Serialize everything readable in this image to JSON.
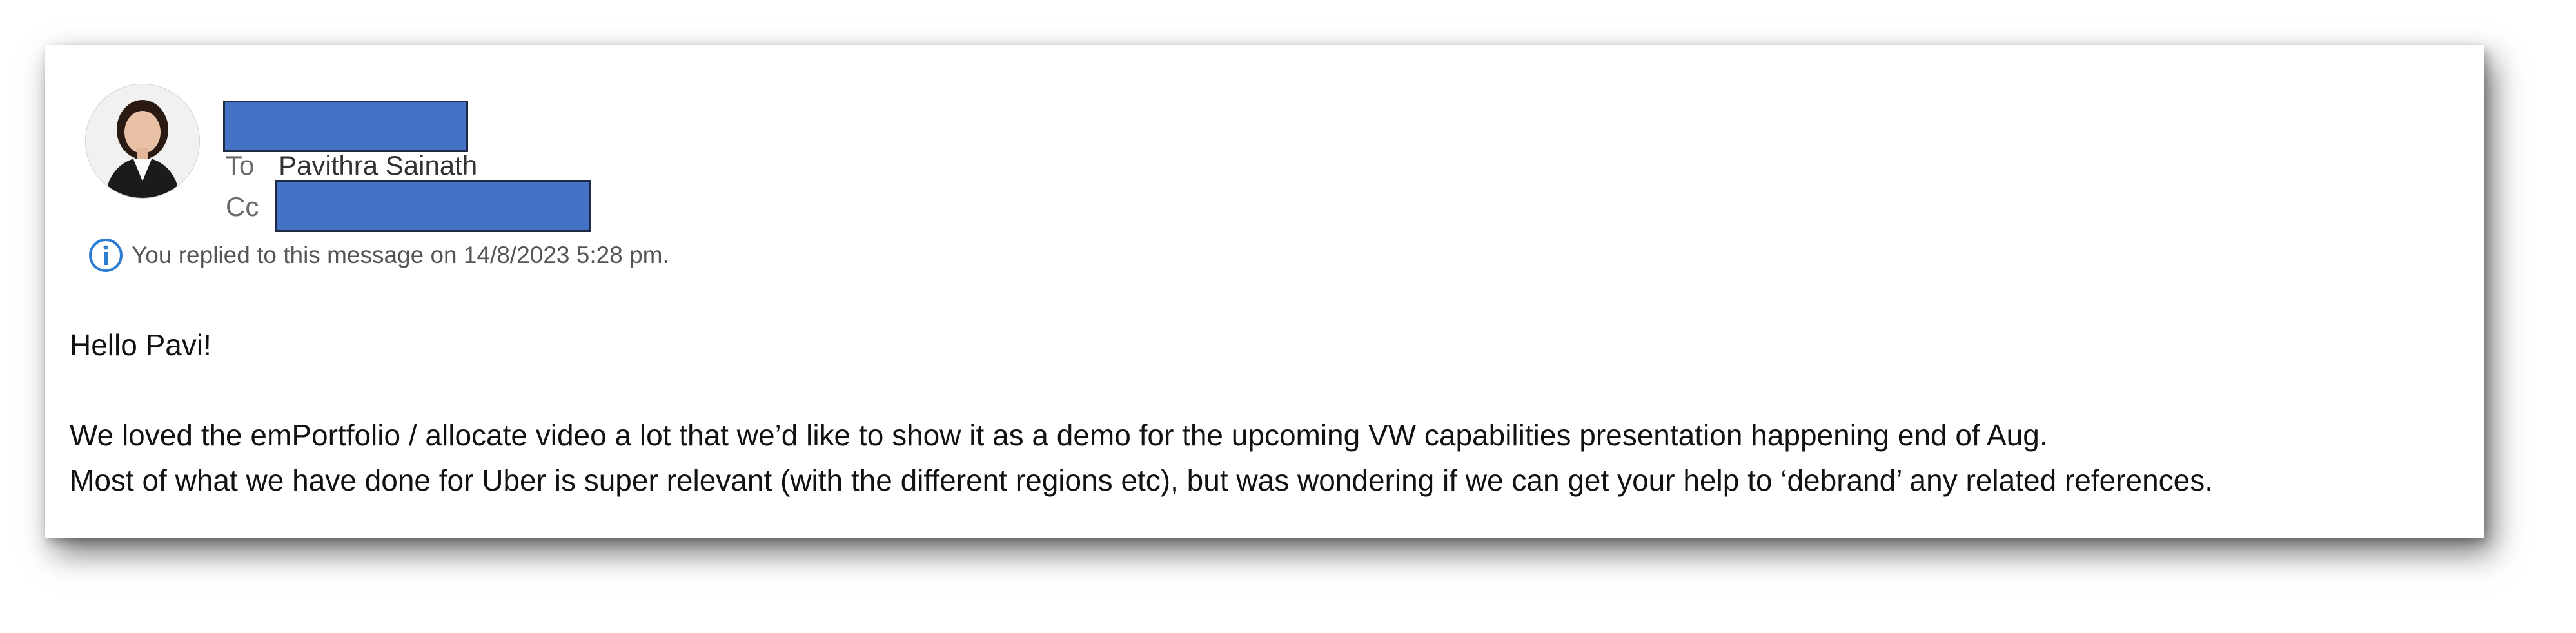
{
  "message": {
    "from_redacted": true,
    "to_label": "To",
    "to_name": "Pavithra Sainath",
    "cc_label": "Cc",
    "cc_redacted": true,
    "reply_notice": "You replied to this message on 14/8/2023 5:28 pm."
  },
  "body": {
    "greeting": "Hello Pavi!",
    "line1": "We loved the emPortfolio / allocate video a lot that we’d like to show it as a demo for the upcoming VW capabilities presentation happening end of Aug.",
    "line2": "Most of what we have done for Uber is super relevant (with the different regions etc), but was wondering if we can get your help to ‘debrand’ any related references."
  },
  "colors": {
    "redaction": "#4472c4",
    "info_icon": "#2b7cd3"
  },
  "icons": {
    "info": "info-icon"
  }
}
